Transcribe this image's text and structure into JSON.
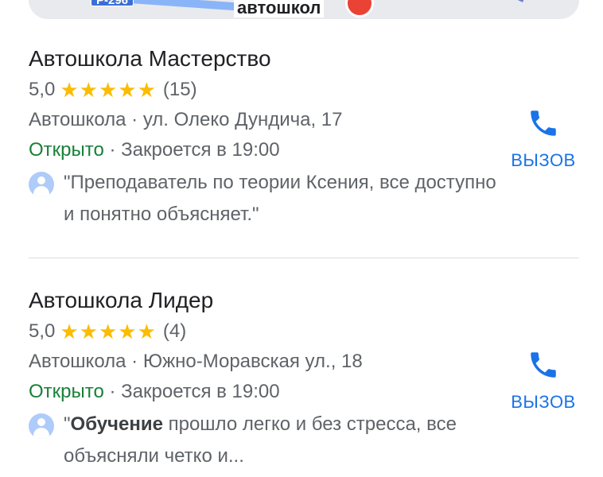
{
  "map": {
    "road_badge": "Р-296",
    "place_label": "автошкол"
  },
  "listings": [
    {
      "name": "Автошкола Мастерство",
      "rating": "5,0",
      "stars": "★★★★★",
      "reviews_count": "(15)",
      "category_address": "Автошкола · ул. Олеко Дундича, 17",
      "status_open": "Открыто",
      "status_close": " · Закроется в 19:00",
      "review_bold": "",
      "review_text": "\"Преподаватель по теории Ксения, все доступно и понятно объясняет.\"",
      "call_label": "ВЫЗОВ"
    },
    {
      "name": "Автошкола Лидер",
      "rating": "5,0",
      "stars": "★★★★★",
      "reviews_count": "(4)",
      "category_address": "Автошкола · Южно-Моравская ул., 18",
      "status_open": "Открыто",
      "status_close": " · Закроется в 19:00",
      "review_prefix": "\"",
      "review_bold": "Обучение",
      "review_text": " прошло легко и без стресса, все объясняли четко и...",
      "call_label": "ВЫЗОВ"
    }
  ],
  "colors": {
    "accent": "#1a73e8",
    "open": "#188038",
    "star": "#fbbc04"
  }
}
